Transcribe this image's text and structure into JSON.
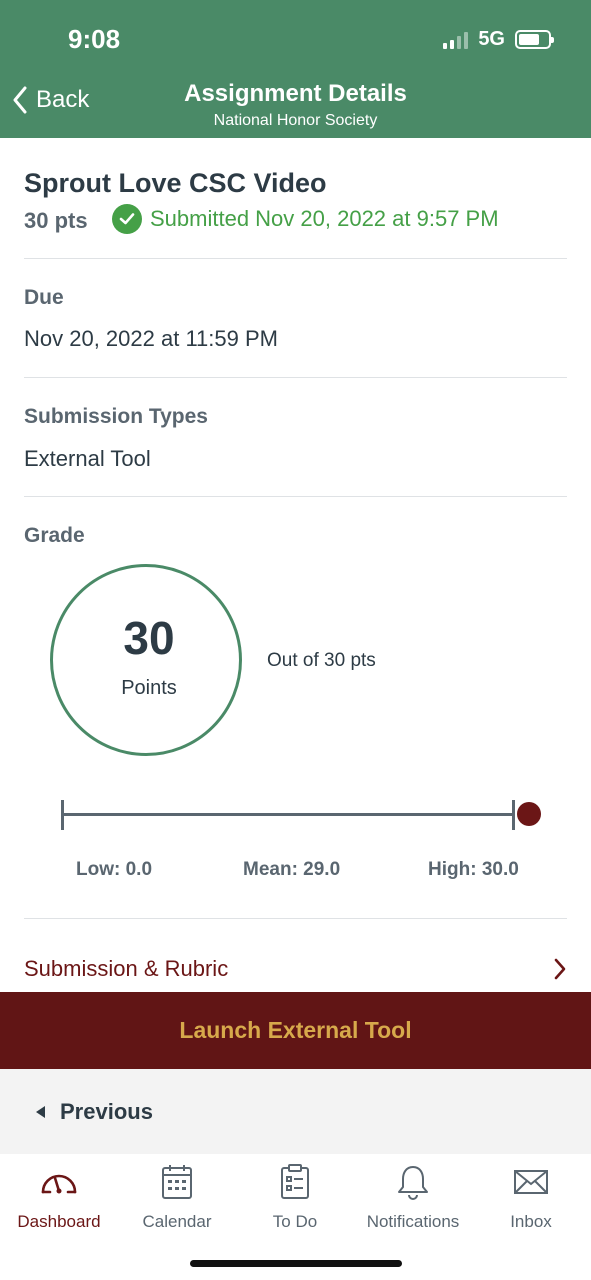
{
  "status_bar": {
    "time": "9:08",
    "network": "5G"
  },
  "nav": {
    "back_label": "Back",
    "title": "Assignment Details",
    "subtitle": "National Honor Society"
  },
  "assignment": {
    "title": "Sprout Love CSC Video",
    "points": "30 pts",
    "submitted_text": "Submitted Nov 20, 2022 at 9:57 PM"
  },
  "due": {
    "label": "Due",
    "value": "Nov 20, 2022 at 11:59 PM"
  },
  "submission_types": {
    "label": "Submission Types",
    "value": "External Tool"
  },
  "grade": {
    "label": "Grade",
    "score": "30",
    "unit": "Points",
    "out_of": "Out of 30 pts",
    "low": "Low: 0.0",
    "mean": "Mean: 29.0",
    "high": "High: 30.0"
  },
  "rubric_link": {
    "label": "Submission & Rubric"
  },
  "launch_button": {
    "label": "Launch External Tool"
  },
  "previous": {
    "label": "Previous"
  },
  "tabs": [
    {
      "label": "Dashboard",
      "icon": "dashboard-icon",
      "active": true
    },
    {
      "label": "Calendar",
      "icon": "calendar-icon"
    },
    {
      "label": "To Do",
      "icon": "todo-icon"
    },
    {
      "label": "Notifications",
      "icon": "bell-icon"
    },
    {
      "label": "Inbox",
      "icon": "mail-icon"
    }
  ],
  "colors": {
    "header_bg": "#4a8a67",
    "accent_maroon": "#611515",
    "gold_text": "#d7a94b",
    "success_green": "#45a047"
  }
}
